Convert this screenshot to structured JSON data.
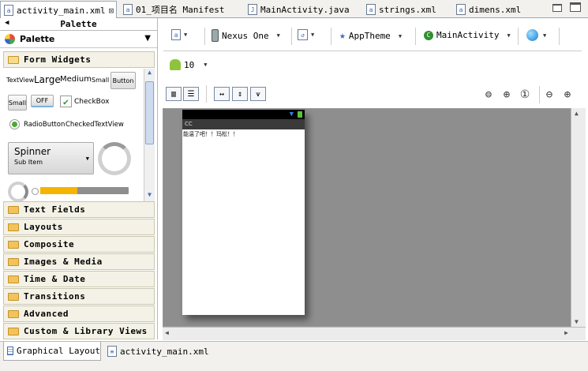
{
  "tabs": [
    {
      "label": "activity_main.xml",
      "close": "⊠"
    },
    {
      "label": "01_项目名 Manifest"
    },
    {
      "label": "MainActivity.java"
    },
    {
      "label": "strings.xml"
    },
    {
      "label": "dimens.xml"
    }
  ],
  "palette": {
    "title": "Palette",
    "dropdown_label": "Palette",
    "open_category": "Form Widgets",
    "widgets": {
      "textview": "TextView",
      "large": "Large",
      "medium": "Medium",
      "small": "Small",
      "button": "Button",
      "small_button": "Small",
      "toggle": "OFF",
      "checkbox": "CheckBox",
      "radio": "RadioButton",
      "checked_text": "CheckedTextView",
      "spinner": "Spinner",
      "spinner_sub": "Sub Item"
    },
    "progress_fill": 0.42,
    "categories": [
      "Text Fields",
      "Layouts",
      "Composite",
      "Images & Media",
      "Time & Date",
      "Transitions",
      "Advanced",
      "Custom & Library Views"
    ]
  },
  "toolbar": {
    "device": "Nexus One",
    "theme": "AppTheme",
    "activity": "MainActivity",
    "api": "10"
  },
  "device_screen": {
    "title": "CC",
    "text": "能温了吧！！玛松！！"
  },
  "bottom_tabs": [
    "Graphical Layout",
    "activity_main.xml"
  ],
  "colors": {
    "accent": "#3a6cc0",
    "progress": "#f5b400",
    "canvas": "#8e8e8e",
    "category_bg": "#f4f2e6"
  }
}
